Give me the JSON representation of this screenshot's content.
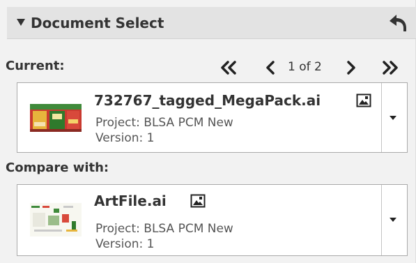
{
  "panel": {
    "title": "Document Select",
    "collapse_icon": "triangle-down-icon",
    "undo_icon": "undo-arrow-icon"
  },
  "current": {
    "label": "Current:",
    "nav": {
      "first_icon": "double-chevron-left-icon",
      "prev_icon": "chevron-left-icon",
      "page_text": "1 of 2",
      "next_icon": "chevron-right-icon",
      "last_icon": "double-chevron-right-icon"
    },
    "document": {
      "name": "732767_tagged_MegaPack.ai",
      "project": "Project: BLSA PCM New",
      "version": "Version: 1",
      "type_icon": "image-icon",
      "dropdown_icon": "caret-down-icon"
    }
  },
  "compare": {
    "label": "Compare with:",
    "document": {
      "name": "ArtFile.ai",
      "project": "Project: BLSA PCM New",
      "version": "Version: 1",
      "type_icon": "image-icon",
      "dropdown_icon": "caret-down-icon"
    }
  },
  "colors": {
    "panel_bg": "#f2f2f2",
    "header_bg": "#e3e3e3",
    "text": "#333333",
    "card_border": "#a9a9a9"
  }
}
